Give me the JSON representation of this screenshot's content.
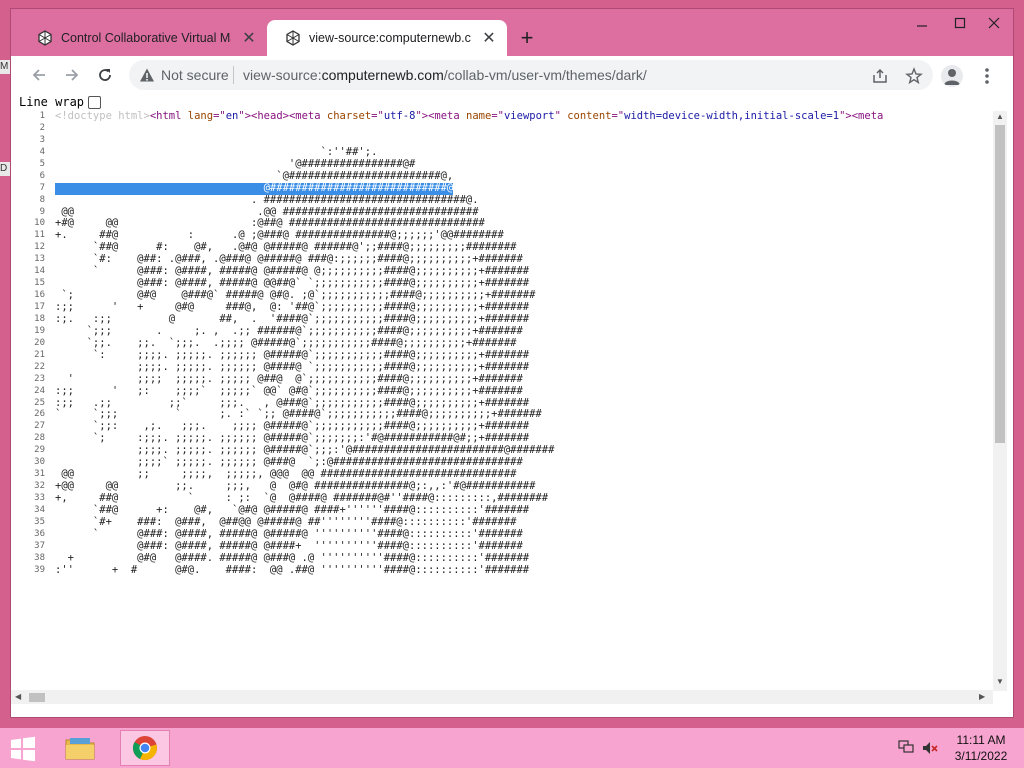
{
  "browser": {
    "tabs": [
      {
        "title": "Control Collaborative Virtual Ma",
        "active": false
      },
      {
        "title": "view-source:computernewb.com",
        "active": true
      }
    ],
    "address": {
      "security_text": "Not secure",
      "url_prefix": "view-source:",
      "url_host": "computernewb.com",
      "url_path": "/collab-vm/user-vm/themes/dark/"
    }
  },
  "page": {
    "line_wrap_label": "Line wrap",
    "line_wrap_checked": false,
    "source_lines": [
      {
        "num": "1",
        "segments": [
          [
            "doctype",
            "<!doctype html>"
          ],
          [
            "tag",
            "<html "
          ],
          [
            "attr",
            "lang"
          ],
          [
            "tag",
            "=\""
          ],
          [
            "val",
            "en"
          ],
          [
            "tag",
            "\">"
          ],
          [
            "tag",
            "<head>"
          ],
          [
            "tag",
            "<meta "
          ],
          [
            "attr",
            "charset"
          ],
          [
            "tag",
            "=\""
          ],
          [
            "val",
            "utf-8"
          ],
          [
            "tag",
            "\">"
          ],
          [
            "tag",
            "<meta "
          ],
          [
            "attr",
            "name"
          ],
          [
            "tag",
            "=\""
          ],
          [
            "val",
            "viewport"
          ],
          [
            "tag",
            "\" "
          ],
          [
            "attr",
            "content"
          ],
          [
            "tag",
            "=\""
          ],
          [
            "val",
            "width=device-width,initial-scale=1"
          ],
          [
            "tag",
            "\">"
          ],
          [
            "tag",
            "<meta"
          ]
        ]
      },
      {
        "num": "2",
        "text": ""
      },
      {
        "num": "3",
        "text": ""
      },
      {
        "num": "4",
        "text": "                                          `:''##';."
      },
      {
        "num": "5",
        "text": "                                     '@################@#"
      },
      {
        "num": "6",
        "text": "                                   `@########################@,"
      },
      {
        "num": "7",
        "text": "                                 @############################@",
        "highlight": true
      },
      {
        "num": "8",
        "text": "                               . ################################@."
      },
      {
        "num": "9",
        "text": " @@                             .@@ ###############################"
      },
      {
        "num": "10",
        "text": "+#@     @@                     :@##@ ###############################"
      },
      {
        "num": "11",
        "text": "+.     ##@           :      .@ ;@###@ ###############@;;;;;;'@@########"
      },
      {
        "num": "12",
        "text": "      `##@      #:    @#,   .@#@ @#####@ ######@';;####@;;;;;;;;;########"
      },
      {
        "num": "13",
        "text": "      `#:    @##: .@###, .@###@ @#####@ ###@:;;;;;;####@;;;;;;;;;;+#######"
      },
      {
        "num": "14",
        "text": "      `      @###: @####, #####@ @#####@ @;;;;;;;;;;####@;;;;;;;;;;+#######"
      },
      {
        "num": "15",
        "text": "             @###: @####, #####@ @@##@` `;;;;;;;;;;;####@;;;;;;;;;;+#######"
      },
      {
        "num": "16",
        "text": " `;          @#@    @###@` #####@ @#@. ;@`;;;;;;;;;;;####@;;;;;;;;;;+#######"
      },
      {
        "num": "17",
        "text": ":;;      '   +     @#@     ###@,  @: '##@`;;;;;;;;;;####@;;;;;;;;;;+#######"
      },
      {
        "num": "18",
        "text": ":;.   :;;         @       ##,  .  '####@`;;;;;;;;;;;####@;;;;;;;;;;+#######"
      },
      {
        "num": "19",
        "text": "     `;;;       .     ;. ,  .;; ######@`;;;;;;;;;;;####@;;;;;;;;;;+#######"
      },
      {
        "num": "20",
        "text": "     `;;.    ;;.  `;;;.  .;;;; @#####@`;;;;;;;;;;;####@;;;;;;;;;;+#######"
      },
      {
        "num": "21",
        "text": "      `:     ;;;;. ;;;;;. ;;;;;; @#####@`;;;;;;;;;;;####@;;;;;;;;;;+#######"
      },
      {
        "num": "22",
        "text": "             ;;;;. ;;;;;. ;;;;;; @####@ `;;;;;;;;;;;####@;;;;;;;;;;+#######"
      },
      {
        "num": "23",
        "text": "  '          ;;;;  ;;;;;. ;;;;; @##@  @`;;;;;;;;;;;####@;;;;;;;;;;+#######"
      },
      {
        "num": "24",
        "text": ":;;      '   ;:    ;;;;`  ;;;;;` @@` @#@`;;;;;;;;;;####@;;;;;;;;;;+#######"
      },
      {
        "num": "25",
        "text": ":;;   .;;         ;;`     ;;;.   , @###@`;;;;;;;;;;;####@;;;;;;;;;;+#######"
      },
      {
        "num": "26",
        "text": "`     `;;;         `      ;. :` `;; @####@`;;;;;;;;;;;####@;;;;;;;;;;+#######"
      },
      {
        "num": "27",
        "text": "      `;;:    ,;.   ;;;.    ;;;; @#####@`;;;;;;;;;;;####@;;;;;;;;;;+#######"
      },
      {
        "num": "28",
        "text": "      `;     :;;;. ;;;;;. ;;;;;; @#####@`;;;;;;;:'#@###########@#;;+#######"
      },
      {
        "num": "29",
        "text": "             ;;;;. ;;;;;. ;;;;;; @#####@`;;;:'@########################@#######"
      },
      {
        "num": "30",
        "text": "             ;;;;` ;;;;;. ;;;;;; @###@  `;:@##############################"
      },
      {
        "num": "31",
        "text": " @@          ;;     ;;;;,  ;;;;;, @@@  @@ ###############################"
      },
      {
        "num": "32",
        "text": "+@@     @@         ;;.     ;;;,   @  @#@ ###############@;:,,:'#@###########"
      },
      {
        "num": "33",
        "text": "+,     ##@           `     : ;:  `@  @####@ #######@#''####@:::::::::,########"
      },
      {
        "num": "34",
        "text": "      `##@      +:    @#,   `@#@ @#####@ ####+''''''####@::::::::::'#######"
      },
      {
        "num": "35",
        "text": "      `#+    ###:  @###,  @##@@ @#####@ ##''''''''####@::::::::::'#######"
      },
      {
        "num": "36",
        "text": "      `      @###: @####, #####@ @#####@ ''''''''''####@::::::::::'#######"
      },
      {
        "num": "37",
        "text": "             @###: @####, #####@ @####+  ''''''''''####@::::::::::'#######"
      },
      {
        "num": "38",
        "text": "  +          @#@   @####. #####@ @###@ .@ ''''''''''####@::::::::::'#######"
      },
      {
        "num": "39",
        "text": ":''      +  #      @#@.    ####:  @@ .##@ ''''''''''####@::::::::::'#######"
      }
    ]
  },
  "taskbar": {
    "time": "11:11 AM",
    "date": "3/11/2022"
  },
  "colors": {
    "desktop": "#d4608e",
    "tabstrip": "#dd6ea0",
    "taskbar": "#f8a4d0",
    "selection": "#3a8ee6"
  }
}
